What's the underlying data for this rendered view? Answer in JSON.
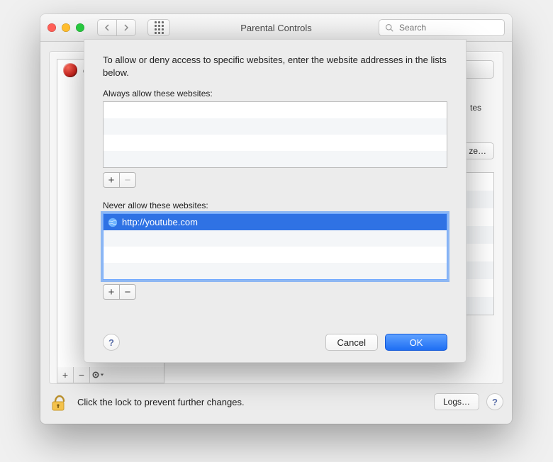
{
  "window": {
    "title": "Parental Controls",
    "search_placeholder": "Search"
  },
  "sidebar": {
    "users": [
      {
        "name": "gues"
      }
    ],
    "footer_gear_label": "⚙"
  },
  "right_pane": {
    "tab_hint_truncated": "tes",
    "customize_button": "ze…"
  },
  "lock_hint": "Click the lock to prevent further changes.",
  "logs_button": "Logs…",
  "sheet": {
    "description": "To allow or deny access to specific websites, enter the website addresses in the lists below.",
    "allow_label": "Always allow these websites:",
    "deny_label": "Never allow these websites:",
    "allow_items": [],
    "deny_items": [
      {
        "url": "http://youtube.com",
        "selected": true
      }
    ],
    "cancel": "Cancel",
    "ok": "OK"
  }
}
